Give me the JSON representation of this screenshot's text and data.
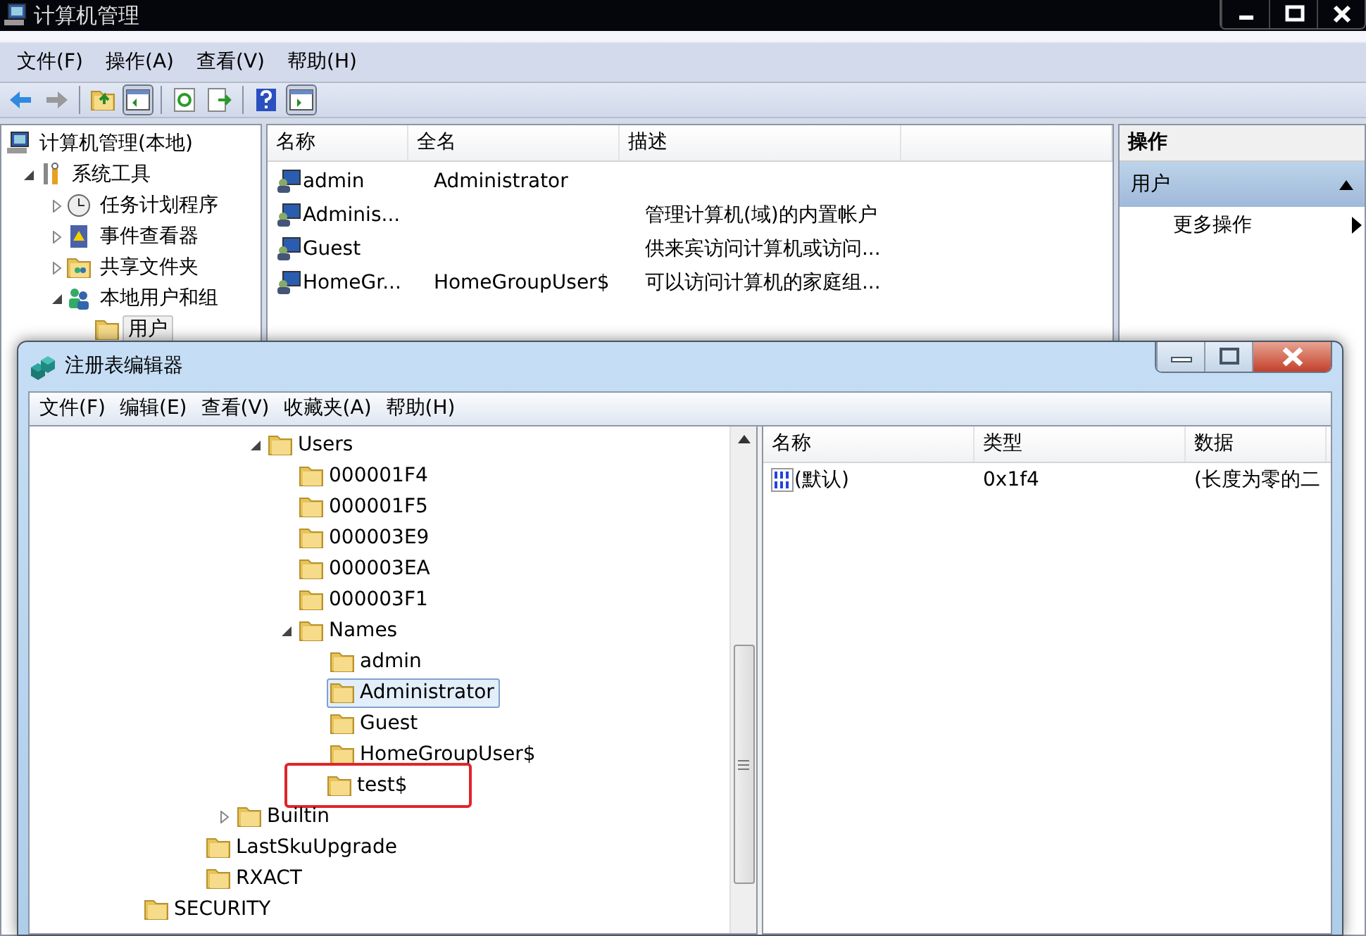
{
  "back_window": {
    "title": "计算机管理",
    "menu": [
      {
        "label": "文件(F)"
      },
      {
        "label": "操作(A)"
      },
      {
        "label": "查看(V)"
      },
      {
        "label": "帮助(H)"
      }
    ],
    "tree": [
      {
        "label": "计算机管理(本地)",
        "selected": false,
        "children": [
          {
            "label": "系统工具",
            "selected": false,
            "expanded": true,
            "children": [
              {
                "label": "任务计划程序",
                "selected": false,
                "expanded": false
              },
              {
                "label": "事件查看器",
                "selected": false,
                "expanded": false
              },
              {
                "label": "共享文件夹",
                "selected": false,
                "expanded": false
              },
              {
                "label": "本地用户和组",
                "selected": false,
                "expanded": true,
                "children": [
                  {
                    "label": "用户",
                    "selected": true
                  }
                ]
              }
            ]
          }
        ]
      }
    ],
    "list": {
      "columns": [
        "名称",
        "全名",
        "描述"
      ],
      "rows": [
        {
          "name": "admin",
          "full_name": "Administrator"
        },
        {
          "name": "Adminis...",
          "description": "管理计算机(域)的内置帐户"
        },
        {
          "name": "Guest",
          "description": "供来宾访问计算机或访问..."
        },
        {
          "name": "HomeGr...",
          "full_name": "HomeGroupUser$",
          "description": "可以访问计算机的家庭组..."
        }
      ]
    },
    "actions": {
      "header": "操作",
      "section": "用户",
      "items": [
        "更多操作"
      ]
    }
  },
  "front_window": {
    "title": "注册表编辑器",
    "menu": [
      {
        "label": "文件(F)"
      },
      {
        "label": "编辑(E)"
      },
      {
        "label": "查看(V)"
      },
      {
        "label": "收藏夹(A)"
      },
      {
        "label": "帮助(H)"
      }
    ],
    "tree": [
      {
        "children": [
          {
            "children": [
              {
                "children": [
                  {
                    "children": [
                      {
                        "label": "Users",
                        "selected": false,
                        "expanded": true,
                        "children": [
                          {
                            "label": "000001F4",
                            "selected": false
                          },
                          {
                            "label": "000001F5",
                            "selected": false
                          },
                          {
                            "label": "000003E9",
                            "selected": false
                          },
                          {
                            "label": "000003EA",
                            "selected": false
                          },
                          {
                            "label": "000003F1",
                            "selected": false
                          },
                          {
                            "label": "Names",
                            "selected": false,
                            "expanded": true,
                            "children": [
                              {
                                "label": "admin",
                                "selected": false
                              },
                              {
                                "label": "Administrator",
                                "selected": true
                              },
                              {
                                "label": "Guest",
                                "selected": false
                              },
                              {
                                "label": "HomeGroupUser$",
                                "selected": false
                              },
                              {
                                "label": "test$",
                                "selected": false,
                                "circled": true
                              }
                            ]
                          }
                        ]
                      }
                    ]
                  },
                  {
                    "label": "Builtin",
                    "selected": false,
                    "expanded": false
                  }
                ]
              },
              {
                "label": "LastSkuUpgrade",
                "selected": false
              },
              {
                "label": "RXACT",
                "selected": false
              }
            ]
          }
        ]
      },
      {
        "label": "SECURITY",
        "selected": false
      }
    ],
    "values": {
      "columns": [
        "名称",
        "类型",
        "数据"
      ],
      "rows": [
        {
          "name": "(默认)",
          "type": "0x1f4",
          "data": "(长度为零的二"
        }
      ]
    }
  }
}
